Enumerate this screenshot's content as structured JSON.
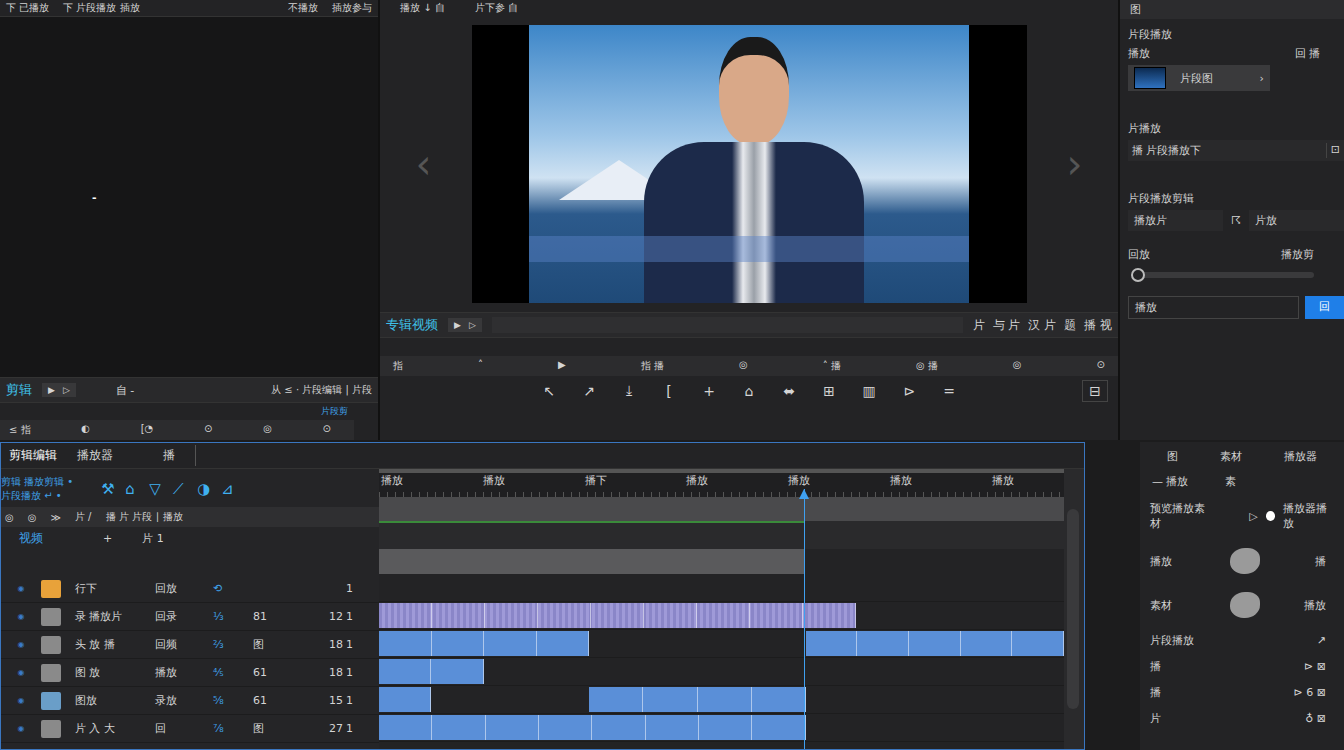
{
  "source_panel": {
    "tabs": [
      "下 已播放",
      "下 片段播放 插放"
    ],
    "right_tabs": [
      "不播放",
      "插放参与"
    ],
    "marker": "-",
    "title": "剪辑",
    "controls": [
      "▶",
      "▷"
    ],
    "info": "自 -",
    "meta": "从 ≤ · 片段编辑 | 片段",
    "sub": "片段剪",
    "toolbar": [
      "≤ 指",
      "◐",
      "[◔",
      "⊙",
      "◎",
      "⊙"
    ]
  },
  "program_panel": {
    "header": [
      "播放 ↓ 自",
      "片下参 自"
    ],
    "title": "专辑视频",
    "controls": [
      "▶",
      "▷"
    ],
    "info": [
      "片",
      "与 片",
      "汉 片",
      "题",
      "播 视"
    ],
    "toolbar": [
      "指",
      "˄",
      "▶",
      "指 播",
      "◎",
      "˄ 播",
      "◎ 播",
      "◎",
      "⊙"
    ],
    "tools": [
      "↖",
      "↗",
      "⤓",
      "[",
      "+",
      "⌂",
      "⬌",
      "⊞",
      "▥",
      "⊳",
      "="
    ],
    "end_tool": "⊟",
    "arrows": [
      "‹",
      "›"
    ]
  },
  "inspector": {
    "title": "图",
    "section1": "片段播放",
    "row1": {
      "label": "播放",
      "value": "回 播"
    },
    "clip": {
      "name": "片段图",
      "arrow": "›"
    },
    "section2": "片播放",
    "field2": "播 片段播放下",
    "field2_icon": "⊡",
    "section3": "片段播放剪辑",
    "pair": [
      {
        "label": "播放片",
        "icon": "☈",
        "value": "片放"
      }
    ],
    "slider_labels": [
      "回放",
      "播放剪"
    ],
    "slider": {
      "level": 0.0
    },
    "input": "播放",
    "button": "回"
  },
  "timeline": {
    "tabs": [
      {
        "label": "剪辑编辑",
        "selected": true
      },
      {
        "label": "播放器",
        "selected": false
      },
      {
        "label": "播",
        "selected": false
      }
    ],
    "lines": [
      "剪辑 播放剪辑 •",
      "片段播放 ↵ •"
    ],
    "tools": [
      "⚒",
      "⌂",
      "▽",
      "⟋",
      "◑",
      "⊿"
    ],
    "header_row": [
      "◎",
      "◎",
      "≫",
      "片 /",
      "播 片 片段 ∣ 播放"
    ],
    "group": {
      "name": "视频",
      "plus": "+",
      "count": "片 1"
    },
    "tracks": [
      {
        "name": "行下",
        "type": "回放",
        "mode": "⟲",
        "a": "",
        "b": "",
        "c": "1",
        "color": "#e8a23a"
      },
      {
        "name": "录 播放片",
        "type": "回录",
        "mode": "⅓",
        "a": "81",
        "b": "12",
        "c": "1",
        "color": "#8a8a8a"
      },
      {
        "name": "头 放 播",
        "type": "回频",
        "mode": "⅔",
        "a": "图",
        "b": "18",
        "c": "1",
        "color": "#8a8a8a"
      },
      {
        "name": "图 放",
        "type": "播放",
        "mode": "⅘",
        "a": "61",
        "b": "18",
        "c": "1",
        "color": "#8a8a8a"
      },
      {
        "name": "图放",
        "type": "录放",
        "mode": "⅝",
        "a": "61",
        "b": "15",
        "c": "1",
        "color": "#6a9ec8"
      },
      {
        "name": "片 入 大",
        "type": "回",
        "mode": "⅞",
        "a": "图",
        "b": "27",
        "c": "1",
        "color": "#8a8a8a"
      }
    ],
    "ruler": [
      "播放",
      "播放",
      "播下",
      "播放",
      "播放",
      "播放",
      "播放"
    ],
    "playhead": {
      "level": 0.62
    }
  },
  "properties": {
    "tabs": [
      "图",
      "素材",
      "播放器"
    ],
    "sub": [
      "— 播放",
      "素"
    ],
    "toggle": {
      "label": "预览播放素材",
      "icon": "▷",
      "on": true,
      "value": "播放器播放"
    },
    "rows": [
      {
        "label": "播放",
        "kind": "swatch",
        "value": "播"
      },
      {
        "label": "素材",
        "kind": "swatch",
        "value": "播放"
      },
      {
        "label": "片段播放",
        "kind": "icon",
        "value": "↗"
      },
      {
        "label": "播",
        "kind": "icon",
        "value": "⊳ ⊠"
      },
      {
        "label": "播",
        "kind": "icon",
        "value": "⊳ 6 ⊠"
      },
      {
        "label": "片",
        "kind": "icon",
        "value": "♁ ⊠"
      }
    ]
  }
}
